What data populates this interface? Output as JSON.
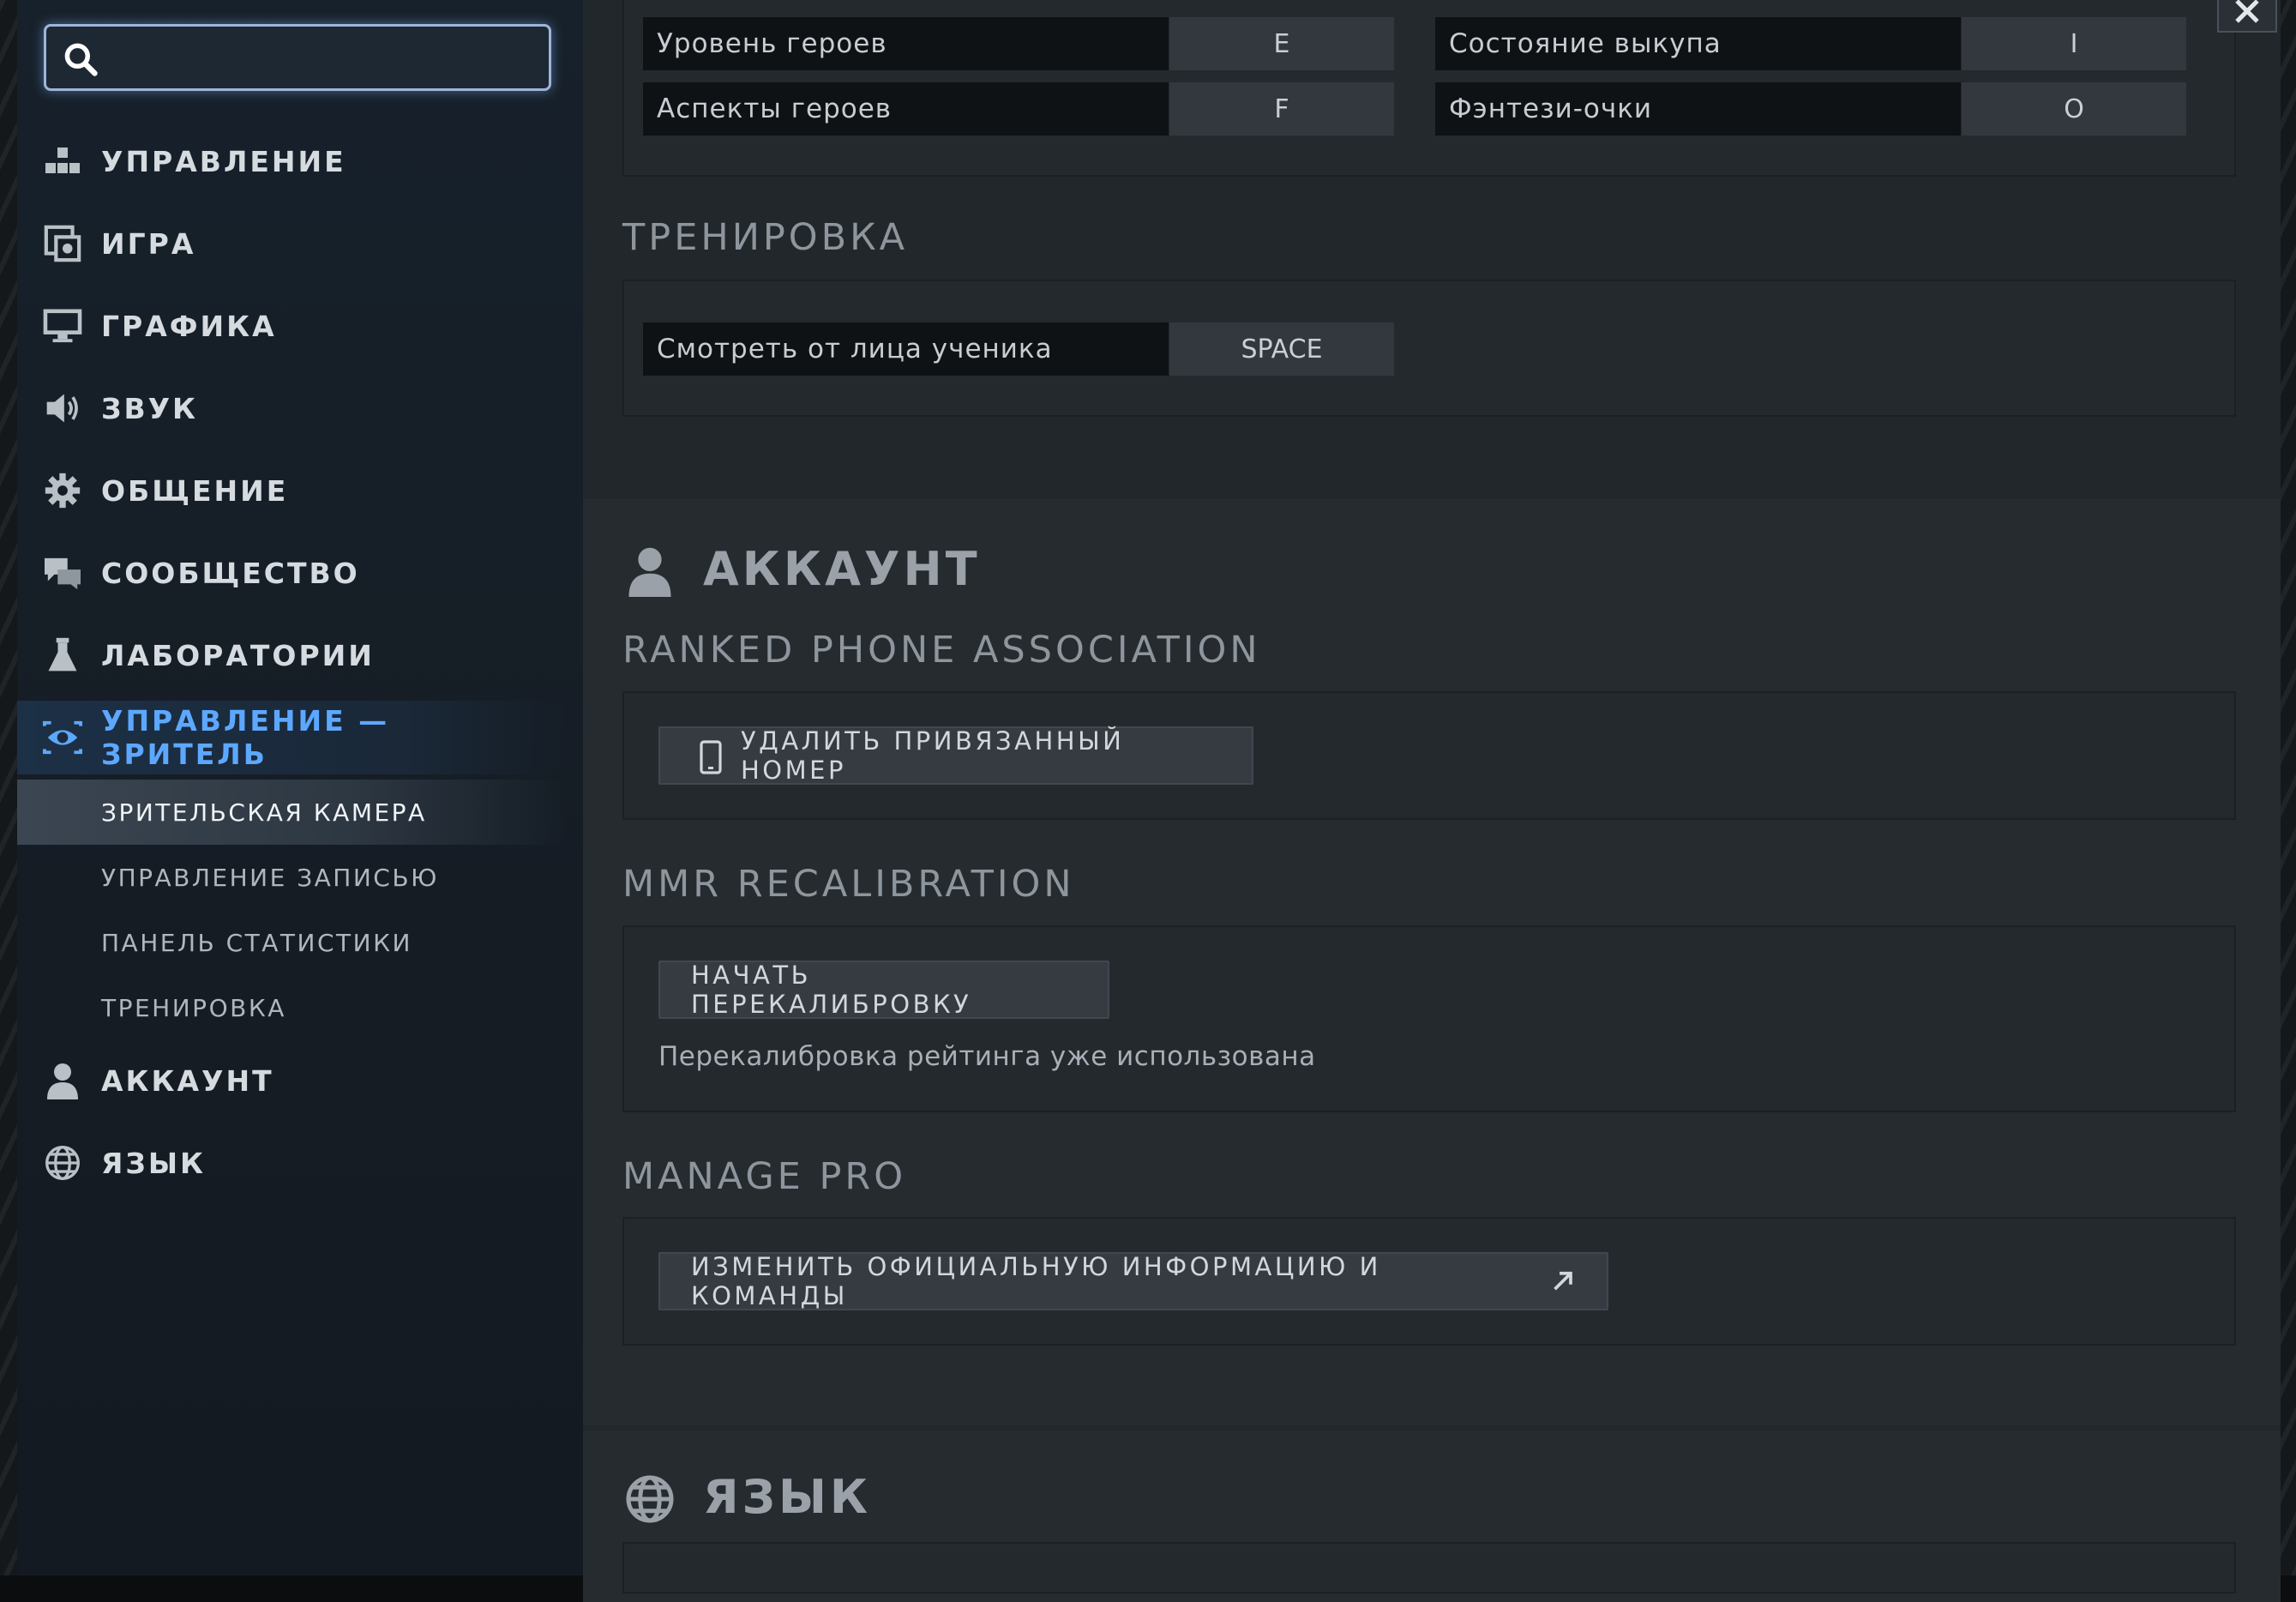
{
  "search": {
    "placeholder": "",
    "value": ""
  },
  "sidebar": {
    "items": [
      {
        "id": "controls",
        "label": "УПРАВЛЕНИЕ",
        "icon": "controls-icon"
      },
      {
        "id": "game",
        "label": "ИГРА",
        "icon": "game-icon"
      },
      {
        "id": "graphics",
        "label": "ГРАФИКА",
        "icon": "monitor-icon"
      },
      {
        "id": "sound",
        "label": "ЗВУК",
        "icon": "speaker-icon"
      },
      {
        "id": "social",
        "label": "ОБЩЕНИЕ",
        "icon": "gear-icon"
      },
      {
        "id": "community",
        "label": "СООБЩЕСТВО",
        "icon": "chat-icon"
      },
      {
        "id": "labs",
        "label": "ЛАБОРАТОРИИ",
        "icon": "flask-icon"
      },
      {
        "id": "spectator",
        "label": "УПРАВЛЕНИЕ — ЗРИТЕЛЬ",
        "icon": "eye-icon",
        "active": true
      },
      {
        "id": "account",
        "label": "АККАУНТ",
        "icon": "user-icon"
      },
      {
        "id": "language",
        "label": "ЯЗЫК",
        "icon": "globe-icon"
      }
    ],
    "subitems": [
      {
        "label": "ЗРИТЕЛЬСКАЯ КАМЕРА",
        "selected": true
      },
      {
        "label": "УПРАВЛЕНИЕ ЗАПИСЬЮ"
      },
      {
        "label": "ПАНЕЛЬ СТАТИСТИКИ"
      },
      {
        "label": "ТРЕНИРОВКА"
      }
    ]
  },
  "keybinds_top": {
    "rows": [
      {
        "left_label": "Уровень героев",
        "left_key": "E",
        "right_label": "Состояние выкупа",
        "right_key": "I"
      },
      {
        "left_label": "Аспекты героев",
        "left_key": "F",
        "right_label": "Фэнтези-очки",
        "right_key": "O"
      }
    ]
  },
  "training": {
    "title": "ТРЕНИРОВКА",
    "row": {
      "label": "Смотреть от лица ученика",
      "key": "SPACE"
    }
  },
  "account": {
    "title": "АККАУНТ",
    "ranked_phone": {
      "title": "RANKED PHONE ASSOCIATION",
      "button": "УДАЛИТЬ ПРИВЯЗАННЫЙ НОМЕР"
    },
    "mmr": {
      "title": "MMR RECALIBRATION",
      "button": "НАЧАТЬ ПЕРЕКАЛИБРОВКУ",
      "note": "Перекалибровка рейтинга уже использована"
    },
    "pro": {
      "title": "MANAGE PRO",
      "button": "ИЗМЕНИТЬ ОФИЦИАЛЬНУЮ ИНФОРМАЦИЮ И КОМАНДЫ"
    }
  },
  "language": {
    "title": "ЯЗЫК"
  },
  "colors": {
    "accent": "#5da8ff",
    "panel": "#22272c",
    "sidebar": "#17212b"
  }
}
